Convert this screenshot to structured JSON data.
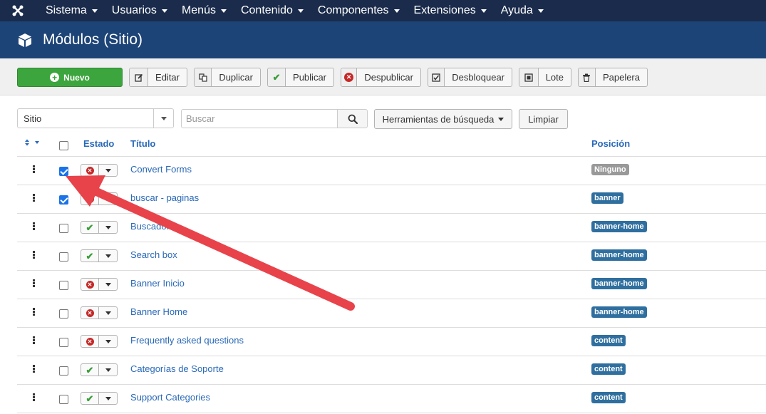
{
  "topnav": {
    "logo_icon": "joomla-logo-icon",
    "items": [
      {
        "label": "Sistema"
      },
      {
        "label": "Usuarios"
      },
      {
        "label": "Menús"
      },
      {
        "label": "Contenido"
      },
      {
        "label": "Componentes"
      },
      {
        "label": "Extensiones"
      },
      {
        "label": "Ayuda"
      }
    ]
  },
  "header": {
    "icon": "cube-icon",
    "title": "Módulos (Sitio)"
  },
  "toolbar": {
    "new_label": "Nuevo",
    "edit_label": "Editar",
    "duplicate_label": "Duplicar",
    "publish_label": "Publicar",
    "unpublish_label": "Despublicar",
    "checkin_label": "Desbloquear",
    "batch_label": "Lote",
    "trash_label": "Papelera"
  },
  "filters": {
    "site_value": "Sitio",
    "search_placeholder": "Buscar",
    "search_tools_label": "Herramientas de búsqueda",
    "clear_label": "Limpiar"
  },
  "table": {
    "headers": {
      "status": "Estado",
      "title": "Título",
      "position": "Posición"
    },
    "rows": [
      {
        "title": "Convert Forms",
        "published": false,
        "checked": true,
        "position": "Ninguno",
        "position_color": "#999999"
      },
      {
        "title": "buscar - paginas",
        "published": false,
        "checked": true,
        "position": "banner",
        "position_color": "#2f6f9f"
      },
      {
        "title": "Buscador",
        "published": true,
        "checked": false,
        "position": "banner-home",
        "position_color": "#2f6f9f"
      },
      {
        "title": "Search box",
        "published": true,
        "checked": false,
        "position": "banner-home",
        "position_color": "#2f6f9f"
      },
      {
        "title": "Banner Inicio",
        "published": false,
        "checked": false,
        "position": "banner-home",
        "position_color": "#2f6f9f"
      },
      {
        "title": "Banner Home",
        "published": false,
        "checked": false,
        "position": "banner-home",
        "position_color": "#2f6f9f"
      },
      {
        "title": "Frequently asked questions",
        "published": false,
        "checked": false,
        "position": "content",
        "position_color": "#2f6f9f"
      },
      {
        "title": "Categorías de Soporte",
        "published": true,
        "checked": false,
        "position": "content",
        "position_color": "#2f6f9f"
      },
      {
        "title": "Support Categories",
        "published": true,
        "checked": false,
        "position": "content",
        "position_color": "#2f6f9f"
      }
    ]
  },
  "annotation": {
    "arrow_color": "#e8434a"
  }
}
